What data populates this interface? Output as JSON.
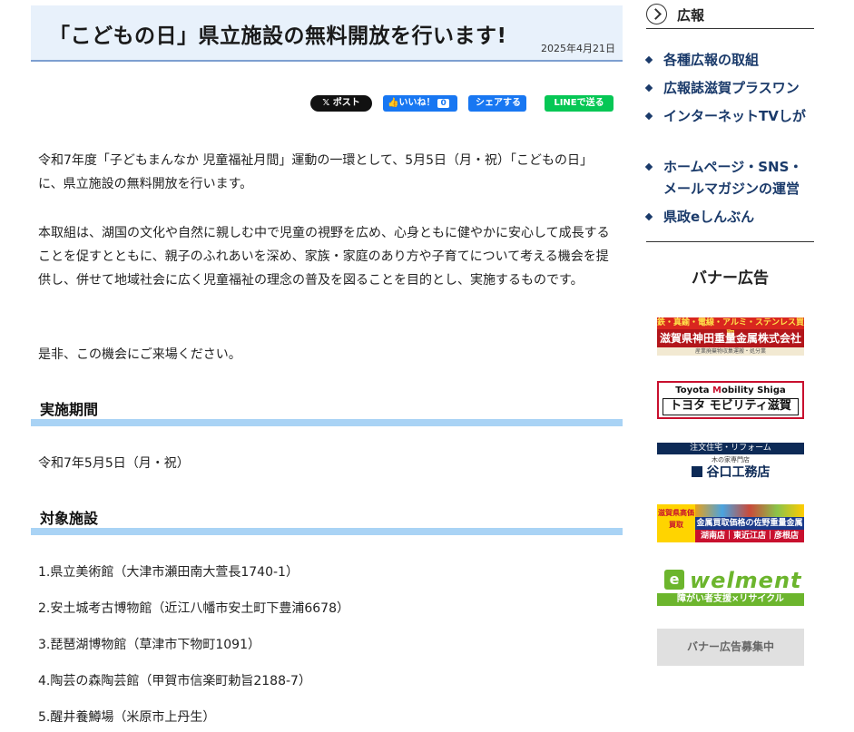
{
  "article": {
    "title": "「こどもの日」県立施設の無料開放を行います!",
    "date": "2025年4月21日"
  },
  "share": {
    "x_label": "𝕏 ポスト",
    "like_label": "いいね！",
    "like_count": "0",
    "share_label": "シェアする",
    "line_label": "LINEで送る"
  },
  "content": {
    "paragraph1": "令和7年度「子どもまんなか 児童福祉月間」運動の一環として、5月5日（月・祝）「こどもの日」に、県立施設の無料開放を行います。",
    "paragraph2": "本取組は、湖国の文化や自然に親しむ中で児童の視野を広め、心身ともに健やかに安心して成長することを促すとともに、親子のふれあいを深め、家族・家庭のあり方や子育てについて考える機会を提供し、併せて地域社会に広く児童福祉の理念の普及を図ることを目的とし、実施するものです。",
    "paragraph3": "是非、この機会にご来場ください。",
    "heading_period": "実施期間",
    "period": "令和7年5月5日（月・祝）",
    "heading_facilities": "対象施設",
    "facilities": [
      "1.県立美術館（大津市瀬田南大萱長1740-1）",
      "2.安土城考古博物館（近江八幡市安土町下豊浦6678）",
      "3.琵琶湖博物館（草津市下物町1091）",
      "4.陶芸の森陶芸館（甲賀市信楽町勅旨2188-7）",
      "5.醒井養鱒場（米原市上丹生）"
    ]
  },
  "sidebar": {
    "title": "広報",
    "items": [
      {
        "label": "各種広報の取組"
      },
      {
        "label": "広報誌滋賀プラスワン"
      },
      {
        "label": "インターネットTVしが"
      },
      {
        "label": "ホームページ・SNS・メールマガジンの運営"
      },
      {
        "label": "県政eしんぶん"
      }
    ],
    "banner_title": "バナー広告",
    "banners": {
      "b1_top": "鉄・真鍮・電線・アルミ・ステンレス買取",
      "b1_main": "滋賀県神田重量金属株式会社",
      "b1_sub": "産業廃棄物収集運搬・処分業",
      "b2_line1_a": "Toyota ",
      "b2_line1_m": "M",
      "b2_line1_b": "obility Shiga",
      "b2_line2": "トヨタ モビリティ滋賀",
      "b3_band": "注文住宅・リフォーム",
      "b3_small": "木の家専門店",
      "b3_name": "谷口工務店",
      "b4_left": "滋賀県高価買取",
      "b4_mid": "金属買取価格の佐野重量金属",
      "b4_bot": "湖南店｜東近江店｜彦根店",
      "b5_icon": "e",
      "b5_logo": "welment",
      "b5_band": "障がい者支援×リサイクル",
      "b6": "バナー広告募集中"
    }
  }
}
